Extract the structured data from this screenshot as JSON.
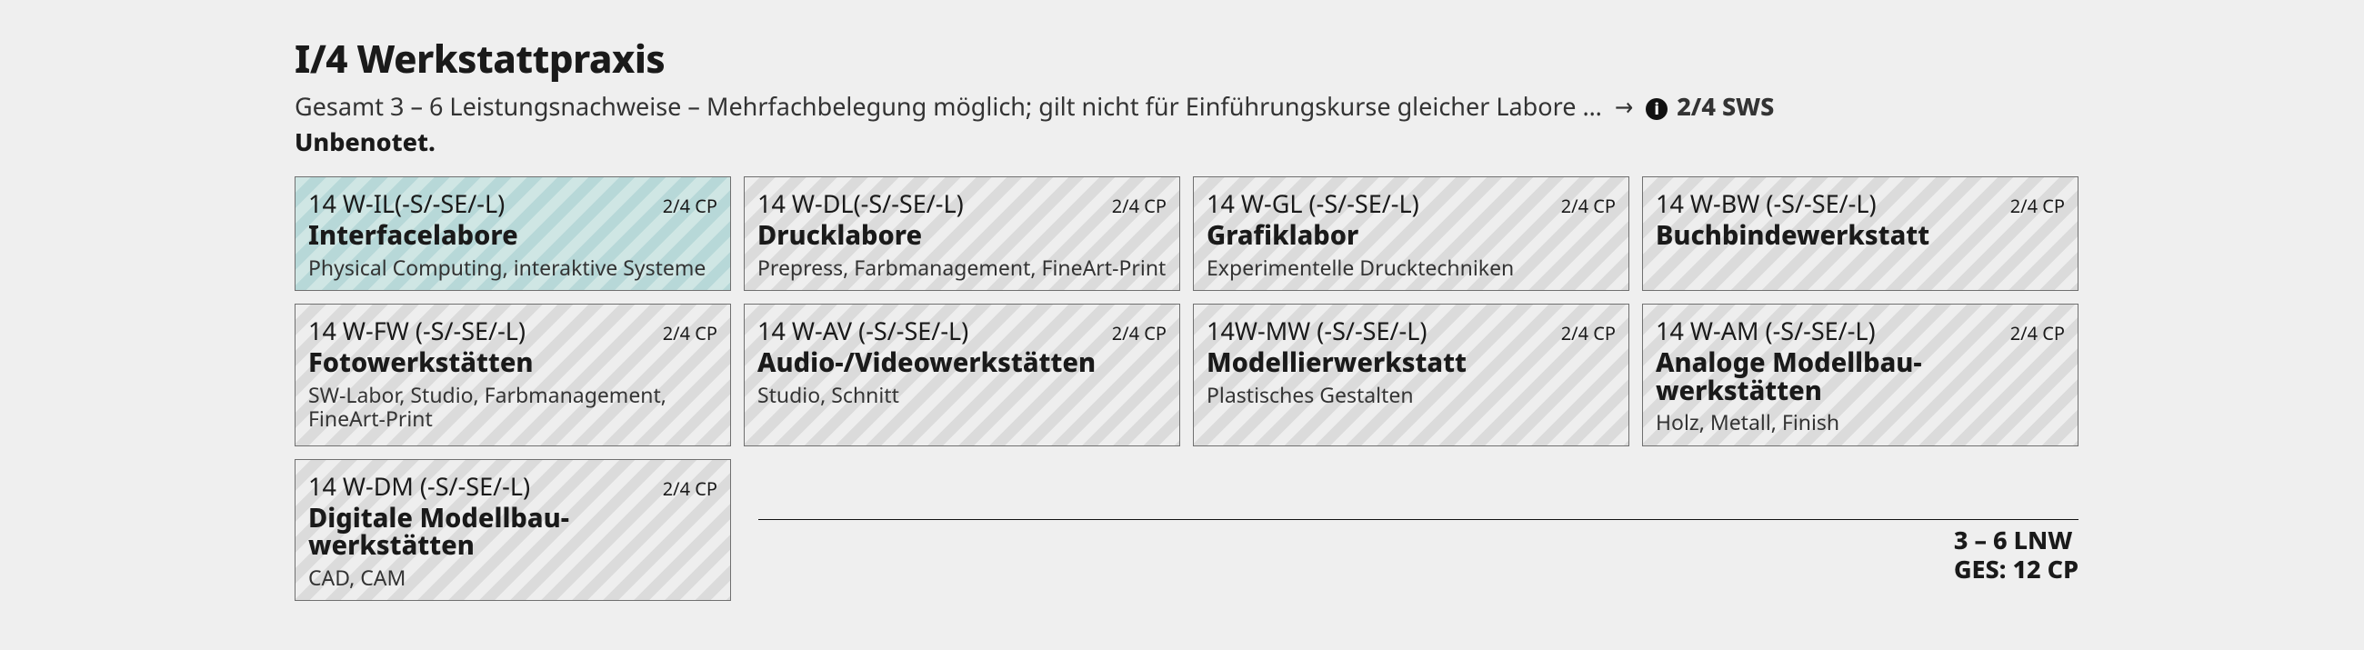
{
  "header": {
    "title": "I/4 Werkstattpraxis",
    "subtitle_prefix": "Gesamt 3 – 6 Leistungsnachweise – Mehrfachbelegung möglich; gilt nicht für Einführungskurse gleicher Labore …",
    "arrow": "→",
    "info_label": "i",
    "sws": "2/4 SWS",
    "ungraded": "Unbenotet."
  },
  "cards": [
    {
      "code": "14 W-IL(-S/-SE/-L)",
      "cp": "2/4 CP",
      "name": "Interfacelabore",
      "desc": "Physical Computing, interaktive Systeme",
      "highlight": true
    },
    {
      "code": "14 W-DL(-S/-SE/-L)",
      "cp": "2/4 CP",
      "name": "Drucklabore",
      "desc": "Prepress, Farbmanagement, FineArt-Print",
      "highlight": false
    },
    {
      "code": "14 W-GL (-S/-SE/-L)",
      "cp": "2/4 CP",
      "name": "Grafiklabor",
      "desc": "Experimentelle Drucktechniken",
      "highlight": false
    },
    {
      "code": "14 W-BW (-S/-SE/-L)",
      "cp": "2/4 CP",
      "name": "Buchbindewerkstatt",
      "desc": "",
      "highlight": false
    },
    {
      "code": "14 W-FW (-S/-SE/-L)",
      "cp": "2/4 CP",
      "name": "Fotowerkstätten",
      "desc": "SW-Labor, Studio, Farb­management, FineArt-Print",
      "highlight": false
    },
    {
      "code": "14 W-AV (-S/-SE/-L)",
      "cp": "2/4 CP",
      "name": "Audio-/Videowerkstätten",
      "desc": "Studio, Schnitt",
      "highlight": false
    },
    {
      "code": "14W-MW (-S/-SE/-L)",
      "cp": "2/4 CP",
      "name": "Modellierwerkstatt",
      "desc": "Plastisches Gestalten",
      "highlight": false
    },
    {
      "code": "14 W-AM (-S/-SE/-L)",
      "cp": "2/4 CP",
      "name": "Analoge Modellbau­werkstätten",
      "desc": "Holz, Metall, Finish",
      "highlight": false
    },
    {
      "code": "14 W-DM (-S/-SE/-L)",
      "cp": "2/4 CP",
      "name": "Digitale Modellbau­werkstätten",
      "desc": "CAD, CAM",
      "highlight": false
    }
  ],
  "footer": {
    "line1": "3 – 6 LNW",
    "line2": "GES: 12 CP"
  }
}
